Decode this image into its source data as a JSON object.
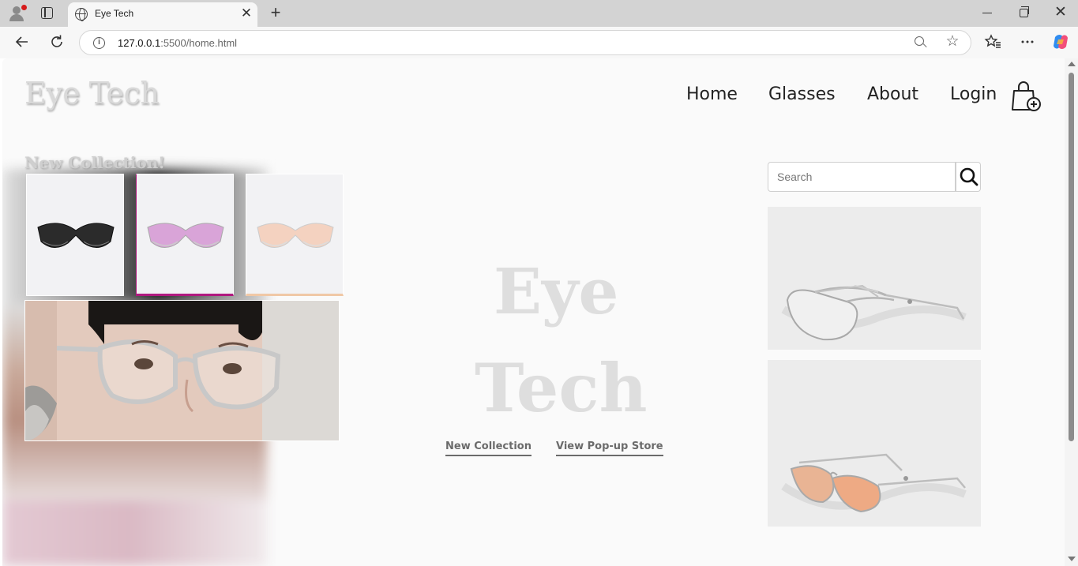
{
  "browser": {
    "tab_title": "Eye Tech",
    "url_host": "127.0.0.1",
    "url_path": ":5500/home.html",
    "new_tab_glyph": "+",
    "close_glyph": "✕"
  },
  "site": {
    "logo": "Eye Tech",
    "nav": [
      "Home",
      "Glasses",
      "About",
      "Login"
    ],
    "cart_icon": "shopping-bag-plus-icon"
  },
  "collection": {
    "title": "New Collection!",
    "thumbnails": [
      {
        "name": "black-sunglasses",
        "lens_color": "#2b2b2b",
        "accent": "#111111"
      },
      {
        "name": "pink-sunglasses",
        "lens_color": "#d9a4d8",
        "accent": "#b0197f"
      },
      {
        "name": "peach-sunglasses",
        "lens_color": "#f4d2c0",
        "accent": "#f0c8a6"
      }
    ]
  },
  "hero": {
    "word1": "Eye",
    "word2": "Tech",
    "links": [
      "New Collection",
      "View Pop-up Store"
    ]
  },
  "search": {
    "placeholder": "Search",
    "icon": "search-icon"
  },
  "products": [
    {
      "name": "clear-frame-glasses"
    },
    {
      "name": "orange-tint-glasses"
    }
  ]
}
